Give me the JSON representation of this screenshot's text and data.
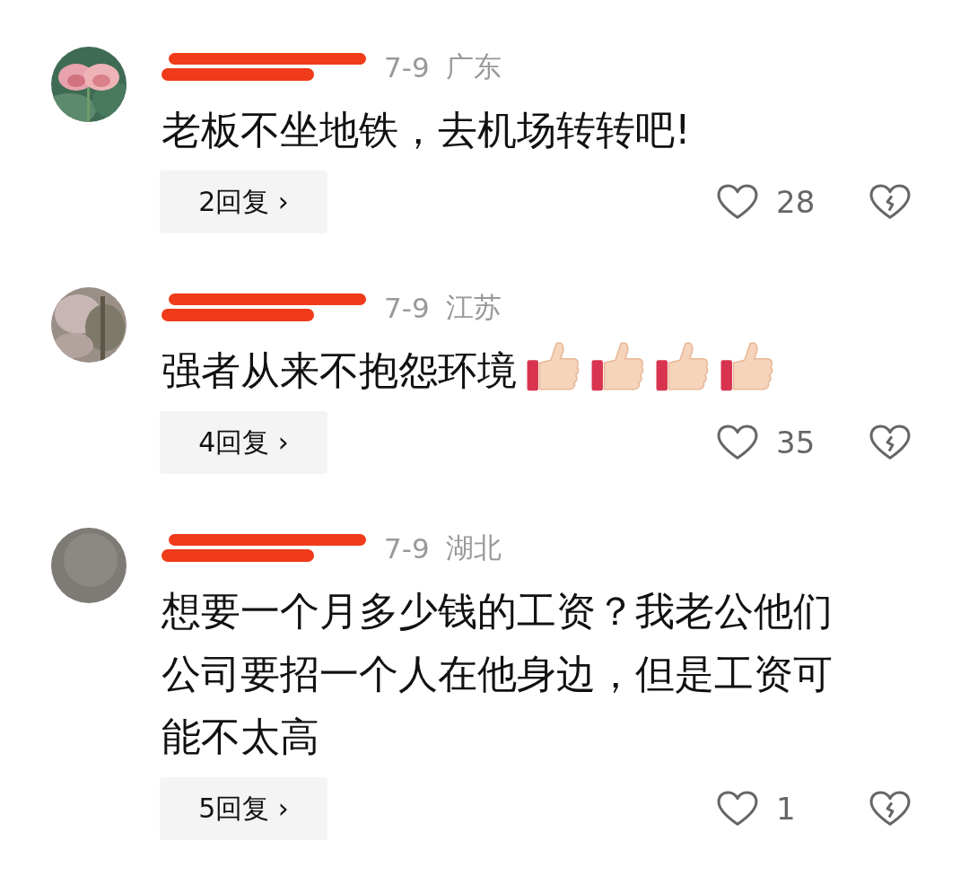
{
  "comments": [
    {
      "date": "7-9",
      "region": "广东",
      "text": "老板不坐地铁，去机场转转吧!",
      "replies": "2回复",
      "chevron": "›",
      "likes": "28"
    },
    {
      "date": "7-9",
      "region": "江苏",
      "text": "强者从来不抱怨环境",
      "emojis": [
        {
          "kind": "thumbs-up"
        },
        {
          "kind": "thumbs-up"
        },
        {
          "kind": "thumbs-up"
        },
        {
          "kind": "thumbs-up"
        }
      ],
      "replies": "4回复",
      "chevron": "›",
      "likes": "35"
    },
    {
      "date": "7-9",
      "region": "湖北",
      "text": "想要一个月多少钱的工资？我老公他们公司要招一个人在他身边，但是工资可能不太高",
      "replies": "5回复",
      "chevron": "›",
      "likes": "1"
    }
  ]
}
